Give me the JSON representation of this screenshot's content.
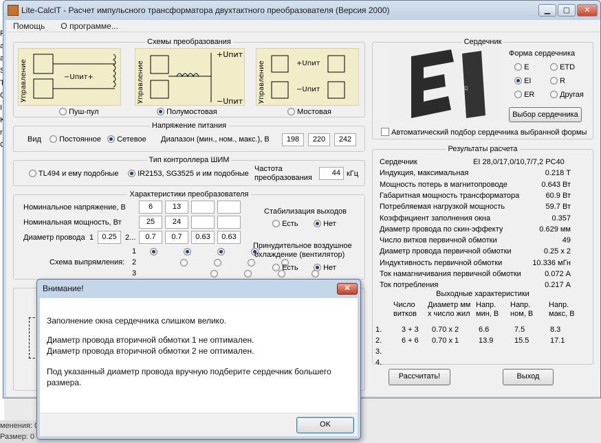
{
  "background": {
    "left_letters": [
      "P",
      "a",
      "a",
      "S",
      "T",
      "C",
      "I",
      "K",
      "r",
      "C"
    ],
    "bottom_lines": [
      "менения: 0",
      "Размер: 0"
    ]
  },
  "window": {
    "title": "Lite-CalcIT - Расчет импульсного трансформатора двухтактного преобразователя (Версия 2000)",
    "controls": {
      "minimize": "▁",
      "maximize": "▢",
      "close": "✕"
    }
  },
  "menu": [
    "Помощь",
    "О программе..."
  ],
  "schemes": {
    "title": "Схемы преобразования",
    "side_label": "Управление",
    "options": [
      {
        "label": "Пуш-пул",
        "selected": false
      },
      {
        "label": "Полумостовая",
        "selected": true
      },
      {
        "label": "Мостовая",
        "selected": false
      }
    ],
    "upit_plus": "+Uпит",
    "upit_minus": "−Uпит",
    "upit_mid": "−Uпит+",
    "upit_bridge": "+Uпит",
    "upit_bridge2": "−Uпит"
  },
  "supply": {
    "title": "Напряжение питания",
    "kind_label": "Вид",
    "options": [
      {
        "label": "Постоянное",
        "selected": false
      },
      {
        "label": "Сетевое",
        "selected": true
      }
    ],
    "range_label": "Диапазон (мин., ном., макс.), В",
    "values": [
      "198",
      "220",
      "242"
    ]
  },
  "pwm": {
    "title": "Тип контроллера ШИМ",
    "options": [
      {
        "label": "TL494 и ему подобные",
        "selected": false
      },
      {
        "label": "IR2153, SG3525 и им подобные",
        "selected": true
      }
    ],
    "freq_label_1": "Частота",
    "freq_label_2": "преобразования",
    "freq_value": "44",
    "freq_unit": "кГц"
  },
  "converter": {
    "title": "Характеристики преобразователя",
    "nom_voltage_label": "Номинальное напряжение, В",
    "nom_voltage": [
      "6",
      "13",
      "",
      ""
    ],
    "nom_power_label": "Номинальная мощность, Вт",
    "nom_power": [
      "25",
      "24",
      "",
      ""
    ],
    "wire_label": "Диаметр провода",
    "wire_n1": "1",
    "wire_primary": "0.25",
    "wire_n2": "2...",
    "wire_values": [
      "0.7",
      "0.7",
      "0.63",
      "0.63"
    ],
    "rect_label": "Схема выпрямления:",
    "rect_rows": [
      "1",
      "2",
      "3"
    ],
    "stab_title": "Стабилизация выходов",
    "stab_options": [
      {
        "label": "Есть",
        "selected": false
      },
      {
        "label": "Нет",
        "selected": true
      }
    ],
    "cool_title_1": "Принудительное воздушное",
    "cool_title_2": "охлаждение (вентилятор)",
    "cool_options": [
      {
        "label": "Есть",
        "selected": false
      },
      {
        "label": "Нет",
        "selected": true
      }
    ]
  },
  "core": {
    "title": "Сердечник",
    "shape_title": "Форма сердечника",
    "shapes": [
      {
        "label": "E",
        "selected": false
      },
      {
        "label": "ETD",
        "selected": false
      },
      {
        "label": "EI",
        "selected": true
      },
      {
        "label": "R",
        "selected": false
      },
      {
        "label": "ER",
        "selected": false
      },
      {
        "label": "Другая",
        "selected": false
      }
    ],
    "select_button": "Выбор сердечника",
    "auto_label": "Автоматический подбор сердечника выбранной формы",
    "logo_text": "EI"
  },
  "results": {
    "title": "Результаты расчета",
    "rows": [
      {
        "label": "Сердечник",
        "value": "EI 28,0/17,0/10,7/7,2 PC40"
      },
      {
        "label": "Индукция, максимальная",
        "value": "0.218 Т"
      },
      {
        "label": "Мощность потерь в магнитопроводе",
        "value": "0.643 Вт"
      },
      {
        "label": "Габаритная мощность трансформатора",
        "value": "60.9 Вт"
      },
      {
        "label": "Потребляемая нагрузкой мощность",
        "value": "59.7 Вт"
      },
      {
        "label": "Коэффициент заполнения окна",
        "value": "0.357"
      },
      {
        "label": "Диаметр провода по скин-эффекту",
        "value": "0.629 мм"
      },
      {
        "label": "Число витков первичной обмотки",
        "value": "49"
      },
      {
        "label": "Диаметр провода первичной обмотки",
        "value": "0.25 x 2"
      },
      {
        "label": "Индуктивность первичной обмотки",
        "value": "10.336 мГн"
      },
      {
        "label": "Ток намагничивания первичной обмотки",
        "value": "0.072 А"
      },
      {
        "label": "Ток потребления",
        "value": "0.217 А"
      }
    ],
    "outputs_title": "Выходные характеристики",
    "out_headers": [
      [
        "Число",
        "витков"
      ],
      [
        "Диаметр мм",
        "x число жил"
      ],
      [
        "Напр.",
        "мин, В"
      ],
      [
        "Напр.",
        "ном, В"
      ],
      [
        "Напр.",
        "макс, В"
      ]
    ],
    "out_rows": [
      {
        "n": "1.",
        "turns": "3 + 3",
        "wire": "0.70 x 2",
        "vmin": "6.6",
        "vnom": "7.5",
        "vmax": "8.3"
      },
      {
        "n": "2.",
        "turns": "6 + 6",
        "wire": "0.70 x 1",
        "vmin": "13.9",
        "vnom": "15.5",
        "vmax": "17.1"
      },
      {
        "n": "3.",
        "turns": "",
        "wire": "",
        "vmin": "",
        "vnom": "",
        "vmax": ""
      },
      {
        "n": "4.",
        "turns": "",
        "wire": "",
        "vmin": "",
        "vnom": "",
        "vmax": ""
      }
    ]
  },
  "buttons": {
    "calculate": "Рассчитать!",
    "exit": "Выход"
  },
  "dialog": {
    "title": "Внимание!",
    "close": "✕",
    "lines": [
      "Заполнение окна сердечника слишком велико.",
      "Диаметр провода вторичной обмотки 1 не оптимален.",
      "Диаметр провода вторичной обмотки 2 не оптимален.",
      "Под указанный диаметр провода вручную подберите сердечник большего",
      "размера."
    ],
    "ok": "OK"
  }
}
